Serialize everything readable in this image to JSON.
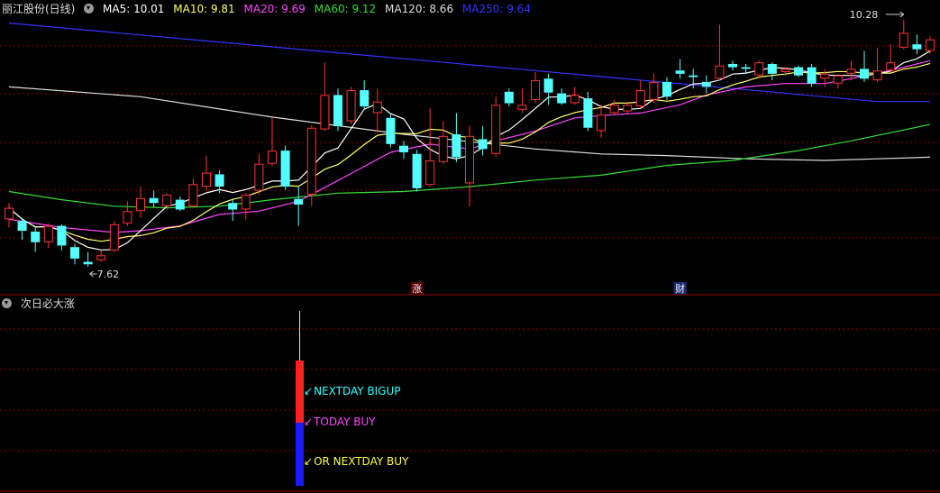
{
  "header": {
    "title": "丽江股份(日线)",
    "ma": [
      {
        "label": "MA5: 10.01",
        "color": "#ffffff"
      },
      {
        "label": "MA10: 9.81",
        "color": "#ffff66"
      },
      {
        "label": "MA20: 9.69",
        "color": "#ff44ff"
      },
      {
        "label": "MA60: 9.12",
        "color": "#33dd33"
      },
      {
        "label": "MA120: 8.66",
        "color": "#dddddd"
      },
      {
        "label": "MA250: 9.64",
        "color": "#3333ff"
      }
    ]
  },
  "indicator": {
    "title": "次日必大涨",
    "labels": [
      {
        "text": "NEXTDAY BIGUP",
        "color": "#33ffff"
      },
      {
        "text": "TODAY BUY",
        "color": "#ff44ff"
      },
      {
        "text": "OR NEXTDAY BUY",
        "color": "#ffff44"
      }
    ]
  },
  "chart_data": {
    "type": "candlestick",
    "ylim": [
      7.3,
      10.75
    ],
    "high_label": "10.28",
    "low_label": "7.62",
    "markers": [
      {
        "index": 31,
        "text": "涨"
      },
      {
        "index": 51,
        "text": "财"
      }
    ],
    "colors": {
      "up": "#ff3232",
      "down": "#54ffff",
      "grid": "#8a0000",
      "frame": "#a00000"
    },
    "ohlc": [
      [
        8.2,
        8.34,
        8.1,
        8.4
      ],
      [
        8.18,
        8.06,
        7.95,
        8.22
      ],
      [
        8.05,
        7.92,
        7.8,
        8.1
      ],
      [
        7.92,
        8.12,
        7.85,
        8.15
      ],
      [
        8.12,
        7.88,
        7.82,
        8.14
      ],
      [
        7.86,
        7.72,
        7.65,
        7.9
      ],
      [
        7.68,
        7.65,
        7.62,
        7.8
      ],
      [
        7.7,
        7.76,
        7.68,
        7.82
      ],
      [
        7.82,
        8.14,
        7.8,
        8.18
      ],
      [
        8.15,
        8.3,
        8.12,
        8.42
      ],
      [
        8.3,
        8.46,
        8.22,
        8.6
      ],
      [
        8.46,
        8.4,
        8.35,
        8.55
      ],
      [
        8.36,
        8.5,
        8.32,
        8.52
      ],
      [
        8.44,
        8.32,
        8.3,
        8.48
      ],
      [
        8.36,
        8.63,
        8.34,
        8.7
      ],
      [
        8.6,
        8.77,
        8.55,
        8.98
      ],
      [
        8.75,
        8.6,
        8.52,
        8.8
      ],
      [
        8.4,
        8.32,
        8.18,
        8.44
      ],
      [
        8.32,
        8.5,
        8.2,
        8.52
      ],
      [
        8.55,
        8.88,
        8.5,
        9.0
      ],
      [
        8.88,
        9.04,
        8.85,
        9.45
      ],
      [
        9.04,
        8.6,
        8.56,
        9.1
      ],
      [
        8.45,
        8.38,
        8.12,
        8.6
      ],
      [
        8.5,
        9.32,
        8.36,
        9.35
      ],
      [
        9.3,
        9.72,
        9.28,
        10.12
      ],
      [
        9.72,
        9.34,
        9.28,
        9.8
      ],
      [
        9.4,
        9.78,
        9.36,
        9.82
      ],
      [
        9.78,
        9.58,
        9.54,
        9.9
      ],
      [
        9.5,
        9.64,
        9.26,
        9.8
      ],
      [
        9.44,
        9.12,
        9.08,
        9.5
      ],
      [
        9.1,
        9.02,
        8.94,
        9.16
      ],
      [
        9.0,
        8.58,
        8.54,
        9.05
      ],
      [
        8.62,
        8.92,
        8.6,
        9.56
      ],
      [
        8.9,
        9.22,
        8.88,
        9.4
      ],
      [
        9.24,
        8.96,
        8.9,
        9.5
      ],
      [
        8.64,
        9.22,
        8.36,
        9.34
      ],
      [
        9.18,
        9.06,
        8.98,
        9.34
      ],
      [
        9.0,
        9.6,
        8.96,
        9.7
      ],
      [
        9.76,
        9.62,
        9.58,
        9.8
      ],
      [
        9.54,
        9.6,
        9.5,
        9.8
      ],
      [
        9.66,
        9.9,
        9.62,
        10.0
      ],
      [
        9.92,
        9.75,
        9.6,
        9.98
      ],
      [
        9.74,
        9.62,
        9.6,
        9.8
      ],
      [
        9.62,
        9.72,
        9.6,
        9.82
      ],
      [
        9.68,
        9.32,
        9.28,
        9.76
      ],
      [
        9.28,
        9.48,
        9.2,
        9.6
      ],
      [
        9.5,
        9.6,
        9.48,
        9.66
      ],
      [
        9.52,
        9.6,
        9.48,
        9.64
      ],
      [
        9.58,
        9.78,
        9.56,
        9.9
      ],
      [
        9.66,
        9.88,
        9.62,
        9.98
      ],
      [
        9.88,
        9.7,
        9.66,
        9.94
      ],
      [
        10.02,
        9.98,
        9.92,
        10.16
      ],
      [
        9.96,
        9.94,
        9.8,
        10.04
      ],
      [
        9.88,
        9.82,
        9.74,
        9.96
      ],
      [
        9.92,
        10.08,
        9.9,
        10.58
      ],
      [
        10.1,
        10.06,
        10.02,
        10.14
      ],
      [
        10.06,
        10.04,
        9.98,
        10.1
      ],
      [
        9.96,
        10.12,
        9.92,
        10.14
      ],
      [
        10.1,
        9.98,
        9.9,
        10.12
      ],
      [
        10.0,
        10.04,
        9.96,
        10.06
      ],
      [
        10.06,
        9.96,
        9.94,
        10.08
      ],
      [
        10.06,
        9.86,
        9.82,
        10.1
      ],
      [
        9.92,
        9.98,
        9.82,
        10.04
      ],
      [
        9.86,
        9.96,
        9.8,
        9.98
      ],
      [
        9.98,
        10.04,
        9.9,
        10.14
      ],
      [
        10.04,
        9.92,
        9.88,
        10.26
      ],
      [
        9.9,
        10.02,
        9.88,
        10.3
      ],
      [
        10.02,
        10.12,
        10.0,
        10.34
      ],
      [
        10.3,
        10.48,
        10.28,
        10.64
      ],
      [
        10.34,
        10.28,
        10.22,
        10.46
      ],
      [
        10.26,
        10.4,
        10.22,
        10.44
      ]
    ],
    "ma250": [
      [
        0,
        10.6
      ],
      [
        66,
        9.64
      ],
      [
        70,
        9.64
      ]
    ],
    "ma120": [
      [
        0,
        9.82
      ],
      [
        10,
        9.7
      ],
      [
        20,
        9.45
      ],
      [
        30,
        9.24
      ],
      [
        40,
        9.06
      ],
      [
        45,
        9.0
      ],
      [
        50,
        8.98
      ],
      [
        56,
        8.94
      ],
      [
        62,
        8.92
      ],
      [
        66,
        8.94
      ],
      [
        70,
        8.96
      ]
    ],
    "ma60": [
      [
        0,
        8.54
      ],
      [
        4,
        8.44
      ],
      [
        8,
        8.36
      ],
      [
        12,
        8.34
      ],
      [
        16,
        8.36
      ],
      [
        20,
        8.44
      ],
      [
        25,
        8.52
      ],
      [
        30,
        8.54
      ],
      [
        35,
        8.6
      ],
      [
        40,
        8.68
      ],
      [
        45,
        8.74
      ],
      [
        50,
        8.86
      ],
      [
        55,
        8.92
      ],
      [
        60,
        9.04
      ],
      [
        64,
        9.16
      ],
      [
        70,
        9.36
      ]
    ],
    "ma20": [
      [
        0,
        8.2
      ],
      [
        4,
        8.1
      ],
      [
        8,
        8.04
      ],
      [
        10,
        8.06
      ],
      [
        13,
        8.12
      ],
      [
        16,
        8.26
      ],
      [
        19,
        8.3
      ],
      [
        22,
        8.42
      ],
      [
        26,
        8.76
      ],
      [
        29,
        9.02
      ],
      [
        32,
        9.12
      ],
      [
        35,
        9.06
      ],
      [
        37,
        9.16
      ],
      [
        40,
        9.28
      ],
      [
        43,
        9.44
      ],
      [
        46,
        9.48
      ],
      [
        48,
        9.5
      ],
      [
        51,
        9.6
      ],
      [
        53,
        9.72
      ],
      [
        56,
        9.82
      ],
      [
        59,
        9.86
      ],
      [
        62,
        9.86
      ],
      [
        64,
        9.92
      ],
      [
        67,
        10.02
      ],
      [
        70,
        10.14
      ]
    ]
  }
}
